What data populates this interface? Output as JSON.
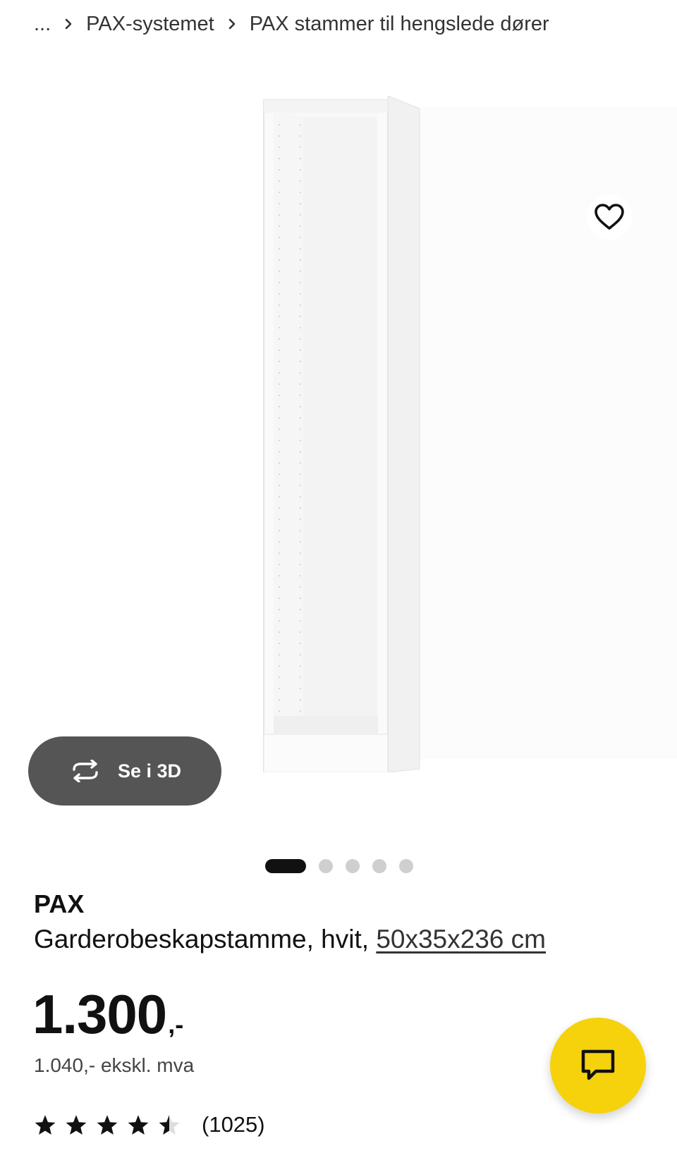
{
  "breadcrumb": {
    "ellipsis": "...",
    "items": [
      "PAX-systemet",
      "PAX stammer til hengslede dører"
    ]
  },
  "gallery": {
    "see_3d_label": "Se i 3D",
    "dot_count": 5,
    "active_index": 0
  },
  "product": {
    "brand": "PAX",
    "description": "Garderobeskapstamme, hvit,",
    "size": "50x35x236 cm",
    "price": "1.300",
    "price_suffix": ",-",
    "price_excl_vat": "1.040,- ekskl. mva",
    "rating": 4.5,
    "review_count": "(1025)"
  },
  "colors": {
    "accent_yellow": "#f5d20b",
    "button_dark": "#555555",
    "text": "#111111"
  },
  "icons": {
    "favorite": "heart-icon",
    "rotate_3d": "rotate-3d-icon",
    "chat": "chat-icon",
    "breadcrumb_separator": "chevron-right-icon"
  }
}
